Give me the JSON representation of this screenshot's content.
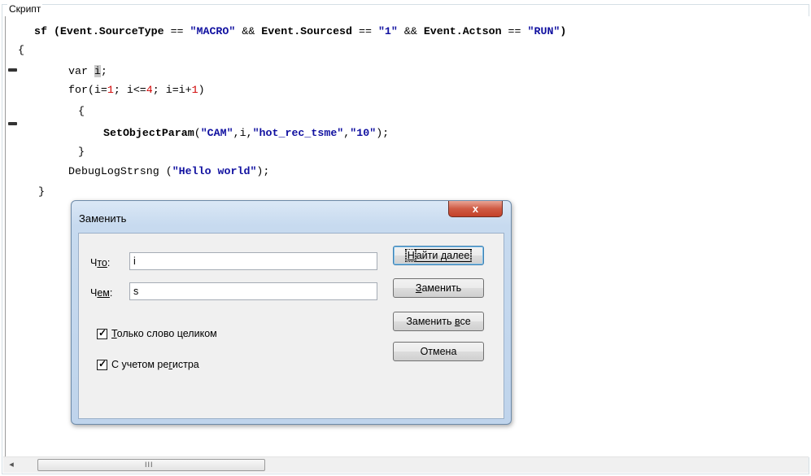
{
  "groupbox": {
    "title": "Скрипт"
  },
  "editor": {
    "lines": [
      {
        "parts": [
          "sf (",
          "Event.SourceType",
          " == ",
          "\"MACRO\"",
          " && ",
          "Event.Sourcesd",
          " == ",
          "\"1\"",
          " && ",
          "Event.Actson",
          " == ",
          "\"RUN\"",
          ")"
        ]
      },
      {
        "text": "{"
      },
      {
        "var": "var ",
        "sel": "i",
        "end": ";"
      },
      {
        "a": "for(i=",
        "n1": "1",
        "b": "; i<=",
        "n2": "4",
        "c": "; i=i+",
        "n3": "1",
        "d": ")"
      },
      {
        "text": "{"
      },
      {
        "fn": "SetObjectParam",
        "open": "(",
        "s1": "\"CAM\"",
        "mid1": ",i,",
        "s2": "\"hot_rec_tsme\"",
        "mid2": ",",
        "s3": "\"10\"",
        "close": ");"
      },
      {
        "text": "}"
      },
      {
        "fn": "DebugLogStrsng",
        "open": " (",
        "s1": "\"Hello world\"",
        "close": ");"
      },
      {
        "text": "}"
      }
    ]
  },
  "scrollbar": {
    "grip": "III",
    "left_arrow": "◂"
  },
  "dialog": {
    "title": "Заменить",
    "close_label": "x",
    "find_label_pre": "Ч",
    "find_label_u": "то",
    "find_label_post": ":",
    "find_value": "i",
    "replace_label_pre": "Ч",
    "replace_label_u": "ем",
    "replace_label_post": ":",
    "replace_value": "s",
    "whole_word_u": "Т",
    "whole_word_rest": "олько слово целиком",
    "whole_word_checked": true,
    "match_case_pre": "С учетом ре",
    "match_case_u": "г",
    "match_case_post": "истра",
    "match_case_checked": true,
    "find_next_u": "Н",
    "find_next_rest": "айти далее",
    "replace_u": "З",
    "replace_rest": "аменить",
    "replace_all_pre": "Заменить ",
    "replace_all_u": "в",
    "replace_all_post": "се",
    "cancel": "Отмена"
  }
}
